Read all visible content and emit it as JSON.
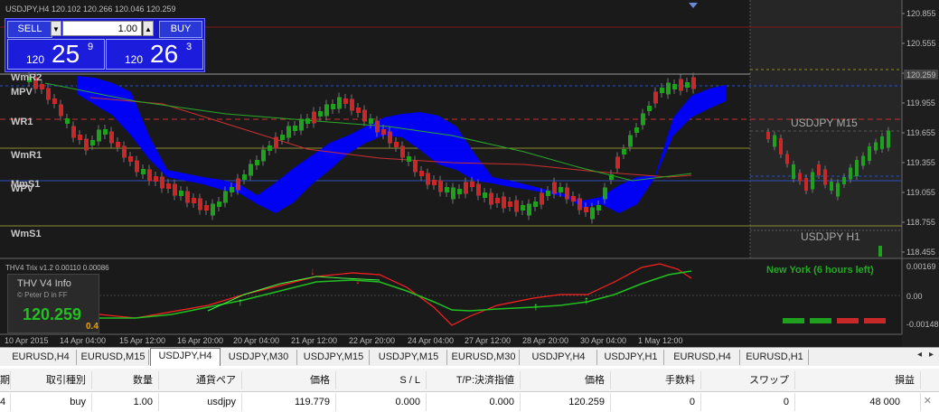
{
  "window": {
    "symbol_title": "USDJPY,H4  120.102 120.266 120.046 120.259",
    "indicator_info": "THV4 Trix v1.2 0.00110 0.00086"
  },
  "trade_panel": {
    "sell_label": "SELL",
    "buy_label": "BUY",
    "lot_value": "1.00",
    "bid": {
      "prefix": "120",
      "big": "25",
      "pip": "9"
    },
    "ask": {
      "prefix": "120",
      "big": "26",
      "pip": "3"
    }
  },
  "price_axis": {
    "labels": [
      "120.855",
      "120.555",
      "120.255",
      "119.955",
      "119.655",
      "119.355",
      "119.055",
      "118.755",
      "118.455"
    ],
    "current_price": "120.259"
  },
  "time_axis": {
    "labels": [
      "10 Apr 2015",
      "14 Apr 04:00",
      "15 Apr 12:00",
      "16 Apr 20:00",
      "20 Apr 04:00",
      "21 Apr 12:00",
      "22 Apr 20:00",
      "24 Apr 04:00",
      "27 Apr 12:00",
      "28 Apr 20:00",
      "30 Apr 04:00",
      "1 May 12:00"
    ]
  },
  "pivot_levels": [
    "WmR2",
    "MPV",
    "WR1",
    "WmR1",
    "MmS1",
    "WPV",
    "WmS1"
  ],
  "mtf_labels": {
    "m15": "USDJPY M15",
    "h1": "USDJPY H1"
  },
  "indicator": {
    "axis_labels": [
      "0.00169",
      "0.00",
      "-0.00148"
    ],
    "title": "THV V4 Info",
    "credit": "© Peter D in FF",
    "price": "120.259",
    "small_value": "0.4",
    "session": "New York   (6 hours left)"
  },
  "tabs": [
    {
      "label": "EURUSD,H4",
      "active": false
    },
    {
      "label": "EURUSD,M15",
      "active": false
    },
    {
      "label": "USDJPY,H4",
      "active": true
    },
    {
      "label": "USDJPY,M30",
      "active": false
    },
    {
      "label": "USDJPY,M15",
      "active": false
    },
    {
      "label": "USDJPY,M15",
      "active": false
    },
    {
      "label": "EURUSD,M30",
      "active": false
    },
    {
      "label": "USDJPY,H4",
      "active": false
    },
    {
      "label": "USDJPY,H1",
      "active": false
    },
    {
      "label": "EURUSD,H4",
      "active": false
    },
    {
      "label": "EURUSD,H1",
      "active": false
    }
  ],
  "orders": {
    "headers": [
      "期",
      "取引種別",
      "数量",
      "通貨ペア",
      "価格",
      "S / L",
      "T/P:決済指値",
      "価格",
      "手数料",
      "スワップ",
      "損益"
    ],
    "row": [
      "4",
      "buy",
      "1.00",
      "usdjpy",
      "119.779",
      "0.000",
      "0.000",
      "120.259",
      "0",
      "0",
      "48 000"
    ]
  },
  "colors": {
    "bull": "#1fa01f",
    "bear": "#c82828",
    "cloud": "#0000ff",
    "trix_red": "#ff2020",
    "trix_green": "#40ff40"
  }
}
